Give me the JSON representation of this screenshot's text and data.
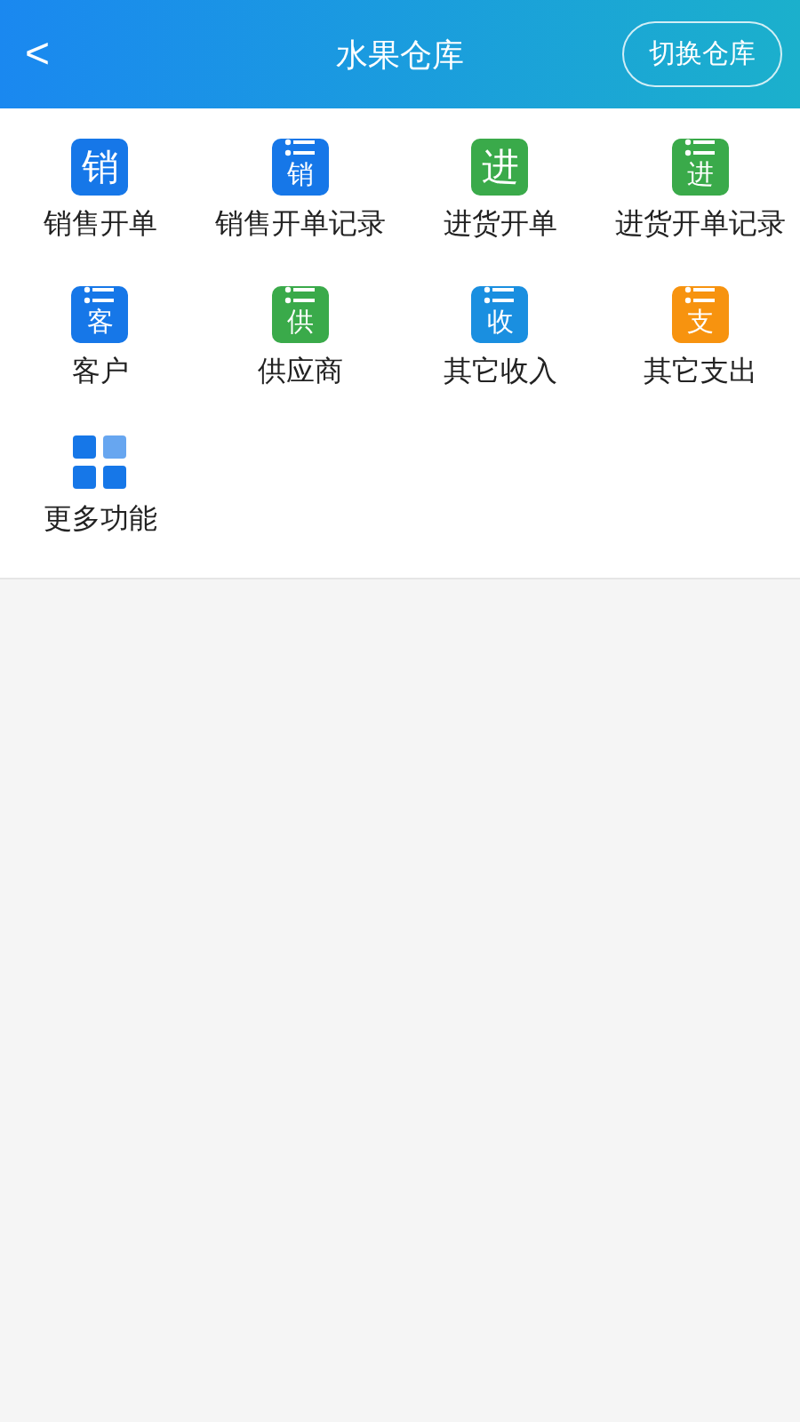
{
  "header": {
    "back": "<",
    "title": "水果仓库",
    "action": "切换仓库"
  },
  "functions": [
    {
      "label": "销售开单",
      "kind": "plain",
      "glyph": "销",
      "color": "#1677e8"
    },
    {
      "label": "销售开单记录",
      "kind": "list",
      "glyph": "销",
      "color": "#1677e8"
    },
    {
      "label": "进货开单",
      "kind": "plain",
      "glyph": "进",
      "color": "#3aaa4a"
    },
    {
      "label": "进货开单记录",
      "kind": "list",
      "glyph": "进",
      "color": "#3aaa4a"
    },
    {
      "label": "客户",
      "kind": "list",
      "glyph": "客",
      "color": "#1677e8"
    },
    {
      "label": "供应商",
      "kind": "list",
      "glyph": "供",
      "color": "#3aaa4a"
    },
    {
      "label": "其它收入",
      "kind": "list",
      "glyph": "收",
      "color": "#1a8fe0"
    },
    {
      "label": "其它支出",
      "kind": "list",
      "glyph": "支",
      "color": "#f7930f"
    },
    {
      "label": "更多功能",
      "kind": "grid",
      "color": "#1677e8"
    }
  ]
}
